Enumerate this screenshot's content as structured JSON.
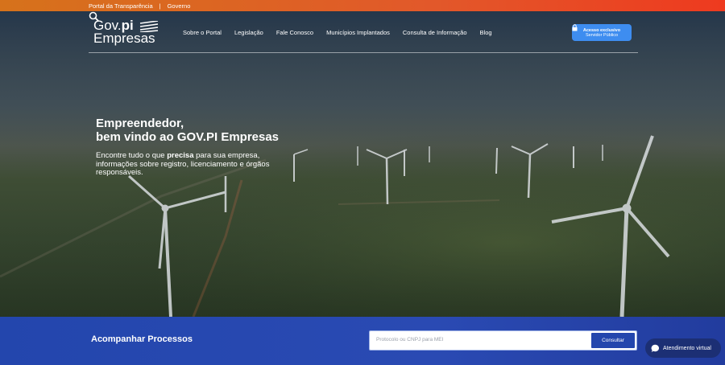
{
  "topbar": {
    "link1": "Portal da Transparência",
    "separator": "|",
    "link2": "Governo"
  },
  "logo": {
    "line1_a": "Gov.",
    "line1_b": "pi",
    "line2": "Empresas"
  },
  "menu": {
    "items": [
      "Sobre o Portal",
      "Legislação",
      "Fale Conosco",
      "Municípios Implantados",
      "Consulta de Informação",
      "Blog"
    ]
  },
  "icons": {
    "search": "search-icon",
    "lock": "lock-icon",
    "chat": "chat-icon"
  },
  "access_button": {
    "line1": "Acesso exclusivo",
    "line2": "Servidor Público"
  },
  "hero": {
    "title_line1": "Empreendedor,",
    "title_line2": "bem vindo ao GOV.PI Empresas",
    "desc_prefix": "Encontre tudo o que ",
    "desc_bold": "precisa",
    "desc_rest": "para sua empresa, informações sobre registro, licenciamento e órgãos responsáveis."
  },
  "processes": {
    "title": "Acompanhar Processos",
    "placeholder": "Protocolo ou CNPJ para MEI",
    "button": "Consultar"
  },
  "chat": {
    "label": "Atendimento virtual"
  },
  "colors": {
    "topbar_start": "#d6721b",
    "topbar_end": "#ee3a1f",
    "bottom_bar": "#2346ad",
    "access_button": "#3e8df0",
    "chat": "#1c2f74"
  }
}
